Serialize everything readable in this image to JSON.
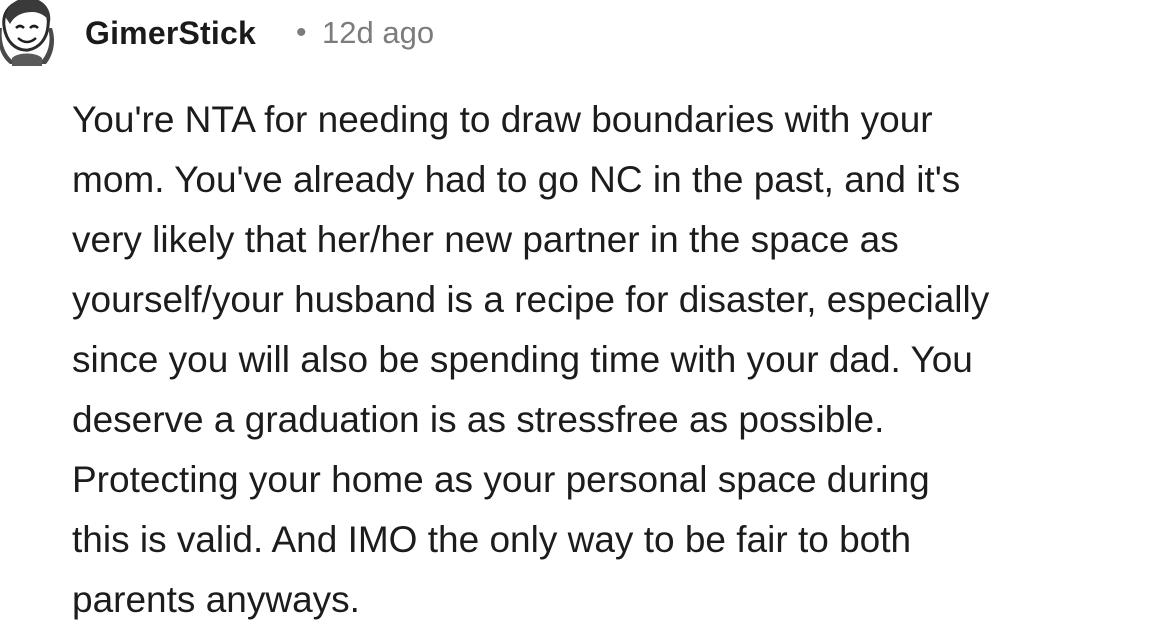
{
  "comment": {
    "author": "GimerStick",
    "separator": "•",
    "timestamp": "12d ago",
    "avatar_icon": "sketch-avatar-icon",
    "body_lines": [
      "You're NTA for needing to draw boundaries with your",
      "mom. You've already had to go NC in the past, and it's",
      "very likely that her/her new partner in the space as",
      "yourself/your husband is a recipe for disaster, especially",
      "since you will also be spending time with your dad. You",
      "deserve a graduation is as stressfree as possible.",
      "Protecting your home as your personal space during",
      "this is valid. And IMO the only way to be fair to both",
      "parents anyways."
    ]
  }
}
